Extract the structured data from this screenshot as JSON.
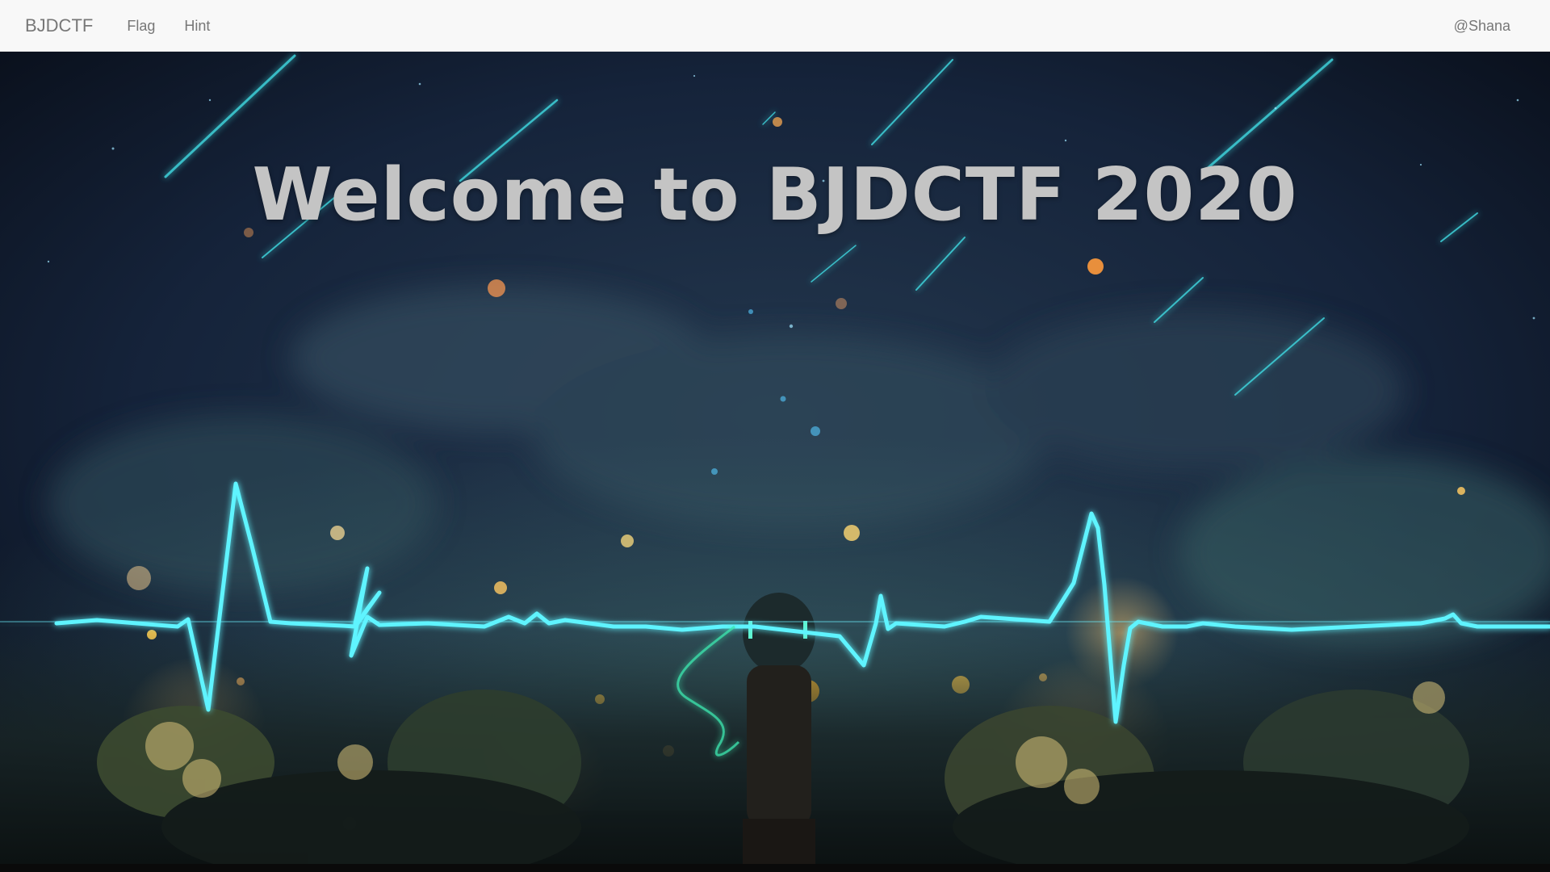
{
  "navbar": {
    "brand": "BJDCTF",
    "links": [
      {
        "label": "Flag"
      },
      {
        "label": "Hint"
      }
    ],
    "user": "@Shana"
  },
  "hero": {
    "title": "Welcome to BJDCTF 2020",
    "background_description_icon": "night-sky-heartbeat-illustration",
    "colors": {
      "sky_top": "#0e1a2c",
      "sky_mid": "#1a2a3e",
      "heartbeat": "#5ff4ff",
      "ember": "#f5c060",
      "foliage": "#2b3a2a",
      "title": "#c4c4c4"
    }
  }
}
